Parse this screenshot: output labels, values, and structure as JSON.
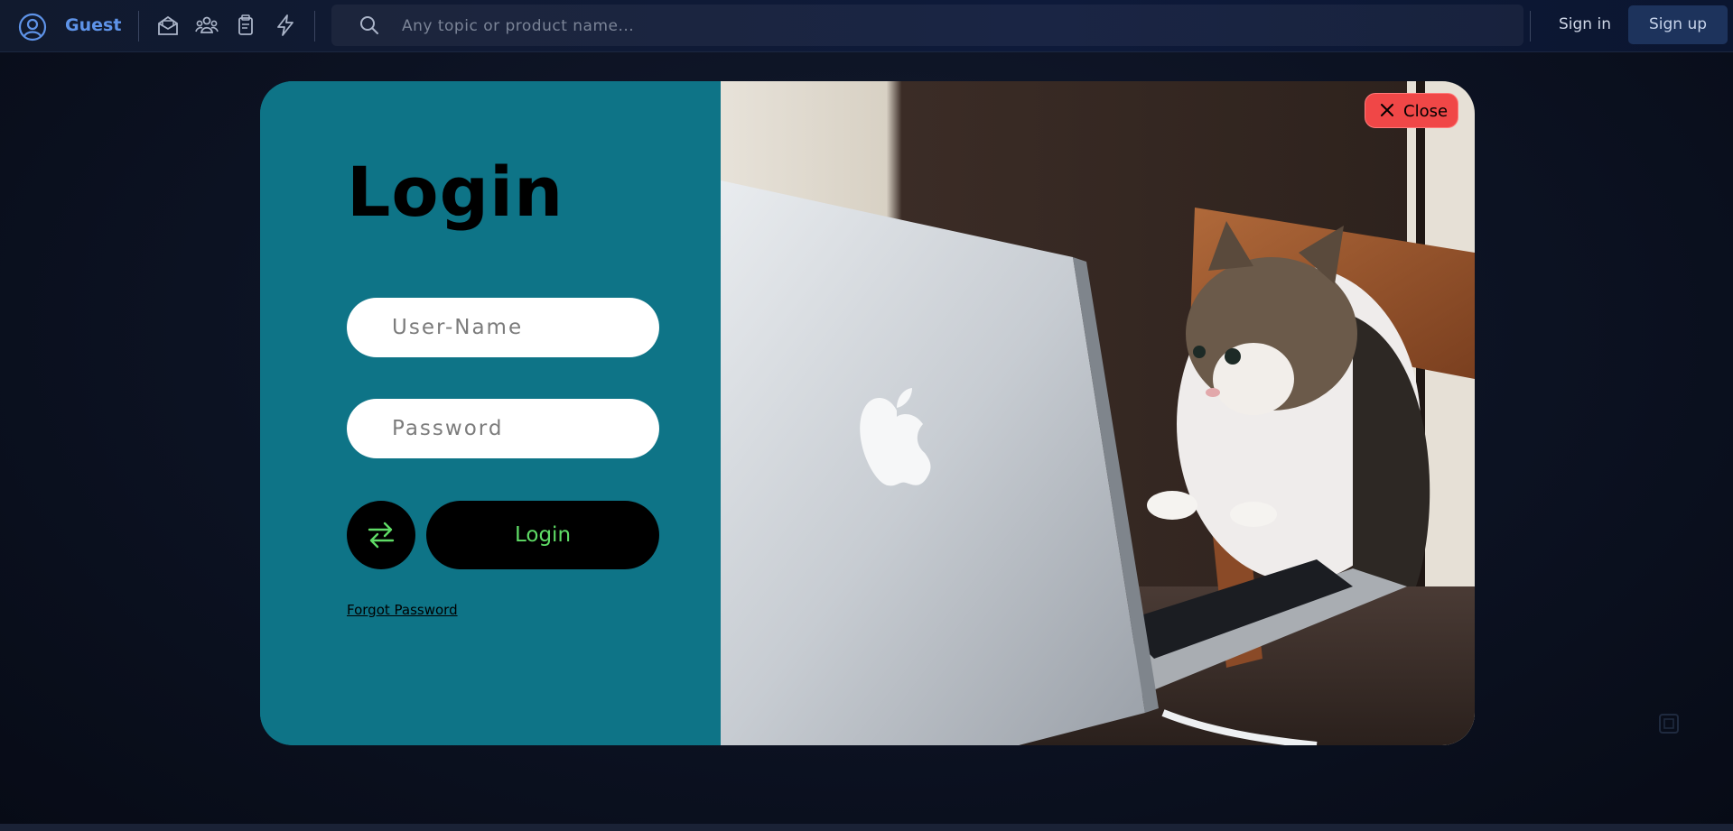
{
  "header": {
    "user_label": "Guest",
    "search_placeholder": "Any topic or product name...",
    "signin_label": "Sign in",
    "signup_label": "Sign up",
    "nav_icons": [
      "mail-open-icon",
      "community-icon",
      "clipboard-icon",
      "lightning-icon"
    ]
  },
  "login": {
    "title": "Login",
    "username_placeholder": "User-Name",
    "password_placeholder": "Password",
    "submit_label": "Login",
    "forgot_label": "Forgot Password",
    "swap_icon": "swap-arrows-icon"
  },
  "modal": {
    "close_label": "Close",
    "image": "cat-using-laptop-photo"
  },
  "colors": {
    "brand": "#5e93e8",
    "login_panel": "#0e7487",
    "login_text": "#5fdc66",
    "close_button": "#f04747"
  }
}
